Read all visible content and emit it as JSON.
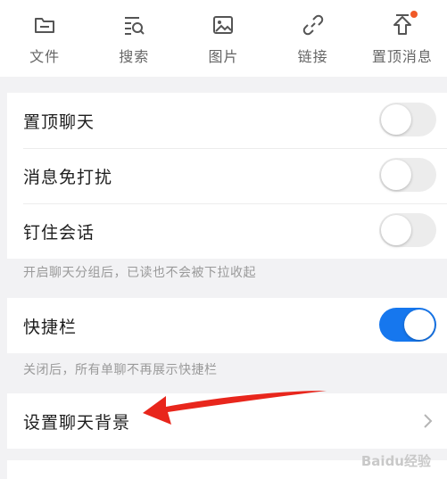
{
  "toolbar": {
    "items": [
      {
        "label": "文件",
        "icon": "folder-icon"
      },
      {
        "label": "搜索",
        "icon": "search-list-icon"
      },
      {
        "label": "图片",
        "icon": "image-icon"
      },
      {
        "label": "链接",
        "icon": "link-icon"
      },
      {
        "label": "置顶消息",
        "icon": "pin-top-icon"
      }
    ]
  },
  "settings": {
    "pin_chat": {
      "label": "置顶聊天",
      "enabled": false
    },
    "mute": {
      "label": "消息免打扰",
      "enabled": false
    },
    "pin_session": {
      "label": "钉住会话",
      "enabled": false
    },
    "pin_note": "开启聊天分组后，已读也不会被下拉收起",
    "shortcut_bar": {
      "label": "快捷栏",
      "enabled": true
    },
    "shortcut_note": "关闭后，所有单聊不再展示快捷栏",
    "chat_background": {
      "label": "设置聊天背景"
    }
  },
  "colors": {
    "accent": "#1677ee",
    "annotation_arrow": "#e8261c",
    "badge": "#f05a28"
  },
  "watermark": "Baidu经验"
}
